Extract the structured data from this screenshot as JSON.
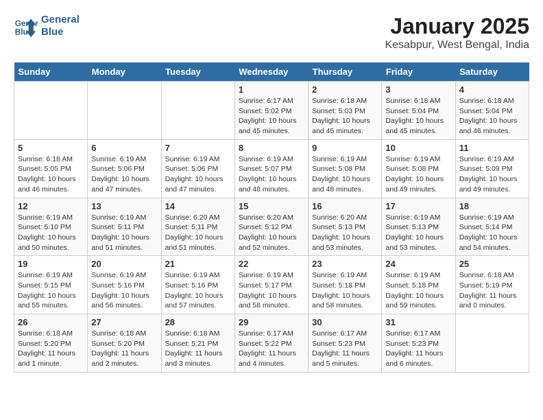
{
  "logo": {
    "line1": "General",
    "line2": "Blue"
  },
  "title": "January 2025",
  "location": "Kesabpur, West Bengal, India",
  "days_header": [
    "Sunday",
    "Monday",
    "Tuesday",
    "Wednesday",
    "Thursday",
    "Friday",
    "Saturday"
  ],
  "weeks": [
    [
      {
        "day": "",
        "info": ""
      },
      {
        "day": "",
        "info": ""
      },
      {
        "day": "",
        "info": ""
      },
      {
        "day": "1",
        "info": "Sunrise: 6:17 AM\nSunset: 5:02 PM\nDaylight: 10 hours\nand 45 minutes."
      },
      {
        "day": "2",
        "info": "Sunrise: 6:18 AM\nSunset: 5:03 PM\nDaylight: 10 hours\nand 45 minutes."
      },
      {
        "day": "3",
        "info": "Sunrise: 6:18 AM\nSunset: 5:04 PM\nDaylight: 10 hours\nand 45 minutes."
      },
      {
        "day": "4",
        "info": "Sunrise: 6:18 AM\nSunset: 5:04 PM\nDaylight: 10 hours\nand 46 minutes."
      }
    ],
    [
      {
        "day": "5",
        "info": "Sunrise: 6:18 AM\nSunset: 5:05 PM\nDaylight: 10 hours\nand 46 minutes."
      },
      {
        "day": "6",
        "info": "Sunrise: 6:19 AM\nSunset: 5:06 PM\nDaylight: 10 hours\nand 47 minutes."
      },
      {
        "day": "7",
        "info": "Sunrise: 6:19 AM\nSunset: 5:06 PM\nDaylight: 10 hours\nand 47 minutes."
      },
      {
        "day": "8",
        "info": "Sunrise: 6:19 AM\nSunset: 5:07 PM\nDaylight: 10 hours\nand 48 minutes."
      },
      {
        "day": "9",
        "info": "Sunrise: 6:19 AM\nSunset: 5:08 PM\nDaylight: 10 hours\nand 48 minutes."
      },
      {
        "day": "10",
        "info": "Sunrise: 6:19 AM\nSunset: 5:08 PM\nDaylight: 10 hours\nand 49 minutes."
      },
      {
        "day": "11",
        "info": "Sunrise: 6:19 AM\nSunset: 5:09 PM\nDaylight: 10 hours\nand 49 minutes."
      }
    ],
    [
      {
        "day": "12",
        "info": "Sunrise: 6:19 AM\nSunset: 5:10 PM\nDaylight: 10 hours\nand 50 minutes."
      },
      {
        "day": "13",
        "info": "Sunrise: 6:19 AM\nSunset: 5:11 PM\nDaylight: 10 hours\nand 51 minutes."
      },
      {
        "day": "14",
        "info": "Sunrise: 6:20 AM\nSunset: 5:11 PM\nDaylight: 10 hours\nand 51 minutes."
      },
      {
        "day": "15",
        "info": "Sunrise: 6:20 AM\nSunset: 5:12 PM\nDaylight: 10 hours\nand 52 minutes."
      },
      {
        "day": "16",
        "info": "Sunrise: 6:20 AM\nSunset: 5:13 PM\nDaylight: 10 hours\nand 53 minutes."
      },
      {
        "day": "17",
        "info": "Sunrise: 6:19 AM\nSunset: 5:13 PM\nDaylight: 10 hours\nand 53 minutes."
      },
      {
        "day": "18",
        "info": "Sunrise: 6:19 AM\nSunset: 5:14 PM\nDaylight: 10 hours\nand 54 minutes."
      }
    ],
    [
      {
        "day": "19",
        "info": "Sunrise: 6:19 AM\nSunset: 5:15 PM\nDaylight: 10 hours\nand 55 minutes."
      },
      {
        "day": "20",
        "info": "Sunrise: 6:19 AM\nSunset: 5:16 PM\nDaylight: 10 hours\nand 56 minutes."
      },
      {
        "day": "21",
        "info": "Sunrise: 6:19 AM\nSunset: 5:16 PM\nDaylight: 10 hours\nand 57 minutes."
      },
      {
        "day": "22",
        "info": "Sunrise: 6:19 AM\nSunset: 5:17 PM\nDaylight: 10 hours\nand 58 minutes."
      },
      {
        "day": "23",
        "info": "Sunrise: 6:19 AM\nSunset: 5:18 PM\nDaylight: 10 hours\nand 58 minutes."
      },
      {
        "day": "24",
        "info": "Sunrise: 6:19 AM\nSunset: 5:18 PM\nDaylight: 10 hours\nand 59 minutes."
      },
      {
        "day": "25",
        "info": "Sunrise: 6:18 AM\nSunset: 5:19 PM\nDaylight: 11 hours\nand 0 minutes."
      }
    ],
    [
      {
        "day": "26",
        "info": "Sunrise: 6:18 AM\nSunset: 5:20 PM\nDaylight: 11 hours\nand 1 minute."
      },
      {
        "day": "27",
        "info": "Sunrise: 6:18 AM\nSunset: 5:20 PM\nDaylight: 11 hours\nand 2 minutes."
      },
      {
        "day": "28",
        "info": "Sunrise: 6:18 AM\nSunset: 5:21 PM\nDaylight: 11 hours\nand 3 minutes."
      },
      {
        "day": "29",
        "info": "Sunrise: 6:17 AM\nSunset: 5:22 PM\nDaylight: 11 hours\nand 4 minutes."
      },
      {
        "day": "30",
        "info": "Sunrise: 6:17 AM\nSunset: 5:23 PM\nDaylight: 11 hours\nand 5 minutes."
      },
      {
        "day": "31",
        "info": "Sunrise: 6:17 AM\nSunset: 5:23 PM\nDaylight: 11 hours\nand 6 minutes."
      },
      {
        "day": "",
        "info": ""
      }
    ]
  ]
}
